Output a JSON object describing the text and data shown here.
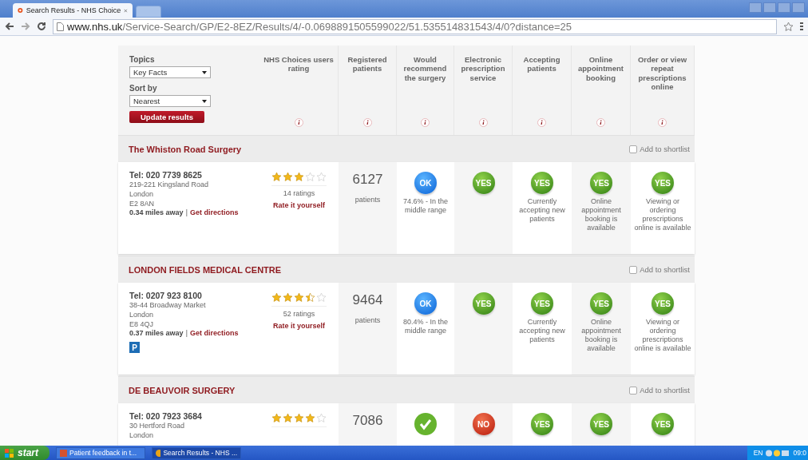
{
  "browser": {
    "tab_title": "Search Results - NHS Choice",
    "url_domain": "www.nhs.uk",
    "url_path": "/Service-Search/GP/E2-8EZ/Results/4/-0.0698891505599022/51.535514831543/4/0?distance=25"
  },
  "filters": {
    "topics_label": "Topics",
    "topics_value": "Key Facts",
    "sort_label": "Sort by",
    "sort_value": "Nearest",
    "button": "Update results"
  },
  "columns": [
    "NHS Choices users rating",
    "Registered patients",
    "Would recommend the surgery",
    "Electronic prescription service",
    "Accepting patients",
    "Online appointment booking",
    "Order or view repeat prescriptions online"
  ],
  "practices": [
    {
      "name": "The Whiston Road Surgery",
      "shortlist": "Add to shortlist",
      "shortlisted": false,
      "tel": "Tel: 020 7739 8625",
      "address": [
        "219-221 Kingsland Road",
        "London",
        "E2 8AN"
      ],
      "distance": "0.34 miles away",
      "separator": "|",
      "directions": "Get directions",
      "stars": 3,
      "ratings": "14 ratings",
      "rate_link": "Rate it yourself",
      "patients": "6127",
      "patients_label": "patients",
      "cells": [
        {
          "kind": "ok",
          "badge": "OK",
          "text": "74.6% - In the middle range"
        },
        {
          "kind": "yes",
          "badge": "YES"
        },
        {
          "kind": "yes",
          "badge": "YES",
          "text": "Currently accepting new patients"
        },
        {
          "kind": "yes",
          "badge": "YES",
          "text": "Online appointment booking is available"
        },
        {
          "kind": "yes",
          "badge": "YES",
          "text": "Viewing or ordering prescriptions online is available"
        }
      ]
    },
    {
      "name": "LONDON FIELDS MEDICAL CENTRE",
      "shortlist": "Add to shortlist",
      "shortlisted": false,
      "tel": "Tel: 0207 923 8100",
      "address": [
        "38-44 Broadway Market",
        "London",
        "E8 4QJ"
      ],
      "distance": "0.37 miles away",
      "separator": "|",
      "directions": "Get directions",
      "parking": true,
      "parking_label": "P",
      "stars": 3.5,
      "ratings": "52 ratings",
      "rate_link": "Rate it yourself",
      "patients": "9464",
      "patients_label": "patients",
      "cells": [
        {
          "kind": "ok",
          "badge": "OK",
          "text": "80.4% - In the middle range"
        },
        {
          "kind": "yes",
          "badge": "YES"
        },
        {
          "kind": "yes",
          "badge": "YES",
          "text": "Currently accepting new patients"
        },
        {
          "kind": "yes",
          "badge": "YES",
          "text": "Online appointment booking is available"
        },
        {
          "kind": "yes",
          "badge": "YES",
          "text": "Viewing or ordering prescriptions online is available"
        }
      ]
    },
    {
      "name": "DE BEAUVOIR SURGERY",
      "shortlist": "Add to shortlist",
      "shortlisted": false,
      "tel": "Tel: 020 7923 3684",
      "address": [
        "30 Hertford Road",
        "London"
      ],
      "stars": 4,
      "patients": "7086",
      "cells": [
        {
          "kind": "tick"
        },
        {
          "kind": "no",
          "badge": "NO"
        },
        {
          "kind": "yes",
          "badge": "YES"
        },
        {
          "kind": "yes",
          "badge": "YES"
        },
        {
          "kind": "yes",
          "badge": "YES"
        }
      ]
    }
  ],
  "taskbar": {
    "start": "start",
    "items": [
      {
        "label": "Patient feedback in t...",
        "kind": "doc",
        "selected": false
      },
      {
        "label": "Search Results - NHS ...",
        "kind": "browser",
        "selected": true
      }
    ],
    "lang": "EN",
    "clock": "09:0"
  }
}
